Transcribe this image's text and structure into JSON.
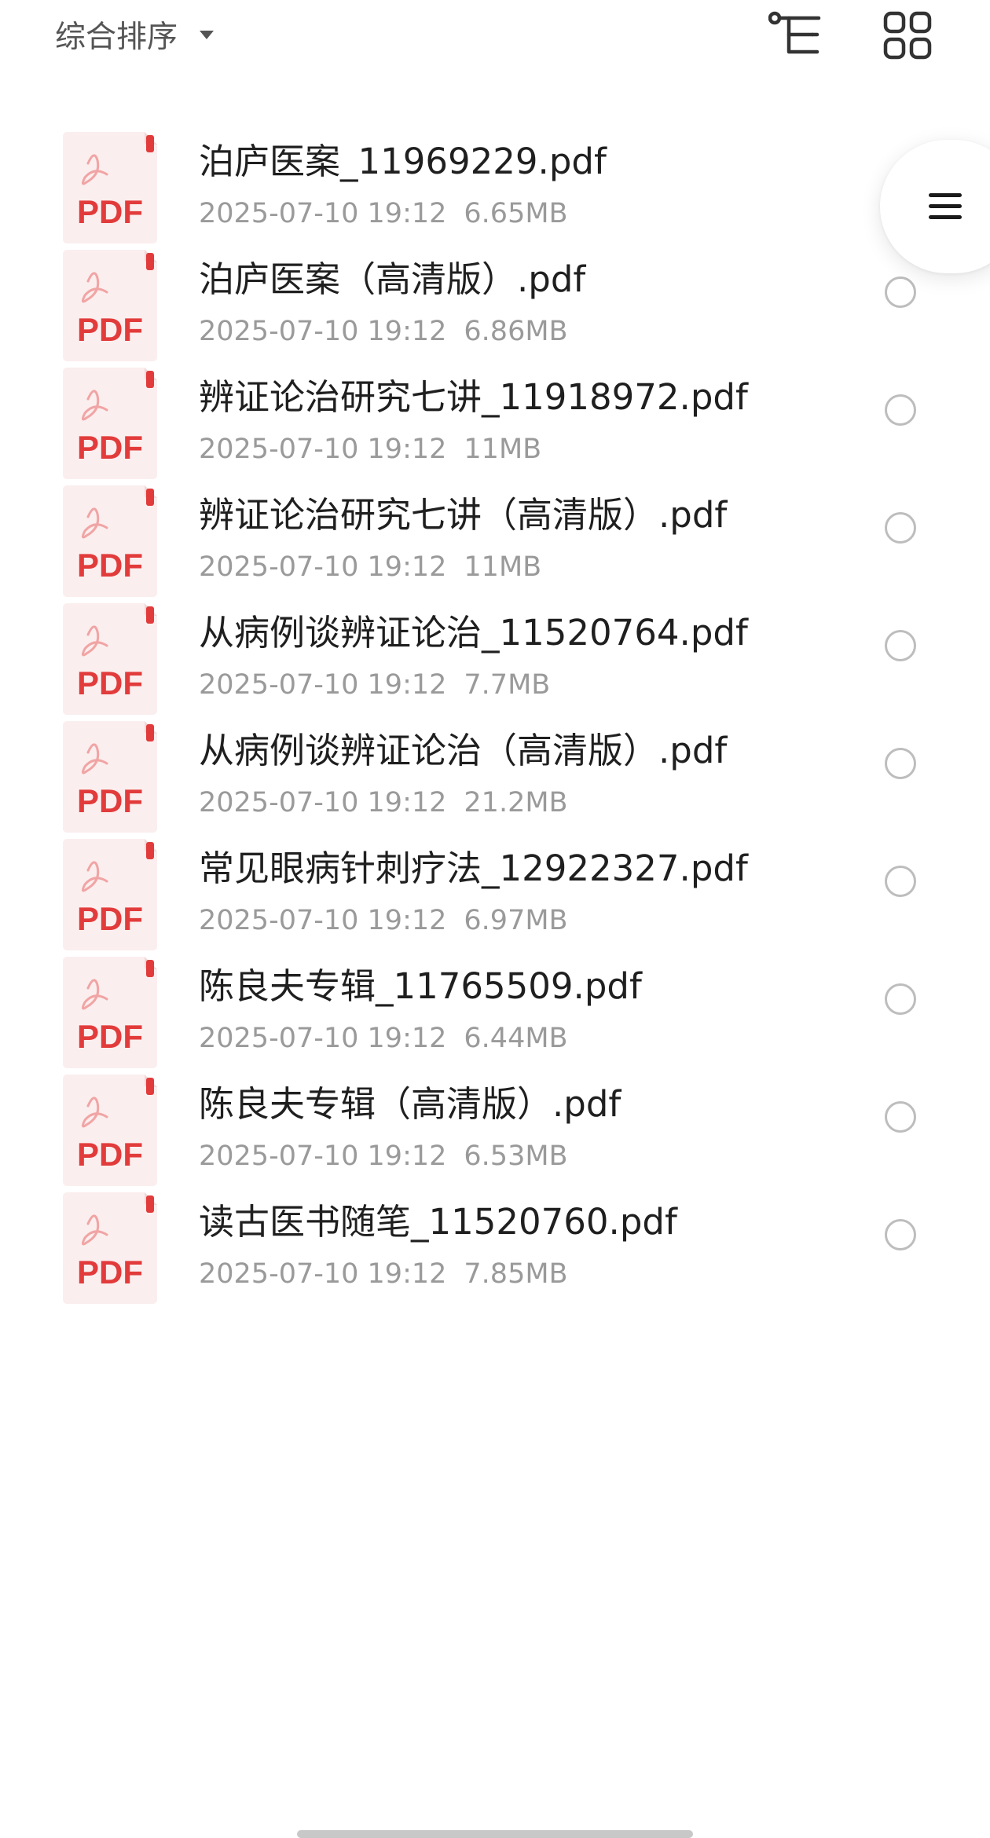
{
  "toolbar": {
    "sort_label": "综合排序",
    "sort_caret_icon": "caret-down-icon",
    "tree_view_icon": "tree-view-icon",
    "grid_view_icon": "grid-view-icon"
  },
  "side_menu": {
    "icon": "menu-icon"
  },
  "file_icon": {
    "label": "PDF",
    "icon": "pdf-file-icon",
    "accent_color": "#e23b3b",
    "bg_color": "#fbeeee"
  },
  "files": [
    {
      "name": "泊庐医案_11969229.pdf",
      "date": "2025-07-10 19:12",
      "size": "6.65MB"
    },
    {
      "name": "泊庐医案（高清版）.pdf",
      "date": "2025-07-10 19:12",
      "size": "6.86MB"
    },
    {
      "name": "辨证论治研究七讲_11918972.pdf",
      "date": "2025-07-10 19:12",
      "size": "11MB"
    },
    {
      "name": "辨证论治研究七讲（高清版）.pdf",
      "date": "2025-07-10 19:12",
      "size": "11MB"
    },
    {
      "name": "从病例谈辨证论治_11520764.pdf",
      "date": "2025-07-10 19:12",
      "size": "7.7MB"
    },
    {
      "name": "从病例谈辨证论治（高清版）.pdf",
      "date": "2025-07-10 19:12",
      "size": "21.2MB"
    },
    {
      "name": "常见眼病针刺疗法_12922327.pdf",
      "date": "2025-07-10 19:12",
      "size": "6.97MB"
    },
    {
      "name": "陈良夫专辑_11765509.pdf",
      "date": "2025-07-10 19:12",
      "size": "6.44MB"
    },
    {
      "name": "陈良夫专辑（高清版）.pdf",
      "date": "2025-07-10 19:12",
      "size": "6.53MB"
    },
    {
      "name": "读古医书随笔_11520760.pdf",
      "date": "2025-07-10 19:12",
      "size": "7.85MB"
    }
  ]
}
